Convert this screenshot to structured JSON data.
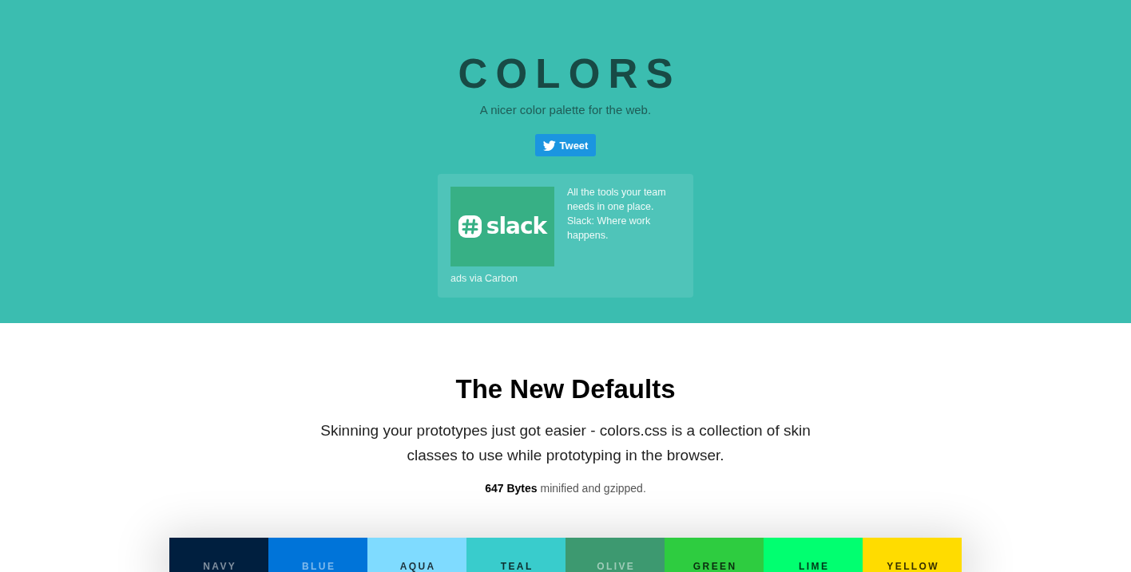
{
  "header": {
    "title": "COLORS",
    "subtitle": "A nicer color palette for the web.",
    "tweet_button": "Tweet"
  },
  "ad": {
    "image_text": "slack",
    "text": "All the tools your team needs in one place. Slack: Where work happens.",
    "credit": "ads via Carbon"
  },
  "intro": {
    "heading": "The New Defaults",
    "description": "Skinning your prototypes just got easier - colors.css is a collection of skin classes to use while prototyping in the browser.",
    "size_note": "**647 Bytes** minified and gzipped."
  },
  "swatches": [
    {
      "name": "NAVY",
      "color": "#001f3f"
    },
    {
      "name": "BLUE",
      "color": "#0074d9"
    },
    {
      "name": "AQUA",
      "color": "#7fdbff"
    },
    {
      "name": "TEAL",
      "color": "#39cccc"
    },
    {
      "name": "OLIVE",
      "color": "#3d9970"
    },
    {
      "name": "GREEN",
      "color": "#2ecc40"
    },
    {
      "name": "LIME",
      "color": "#01ff70"
    },
    {
      "name": "YELLOW",
      "color": "#ffdc00"
    }
  ]
}
